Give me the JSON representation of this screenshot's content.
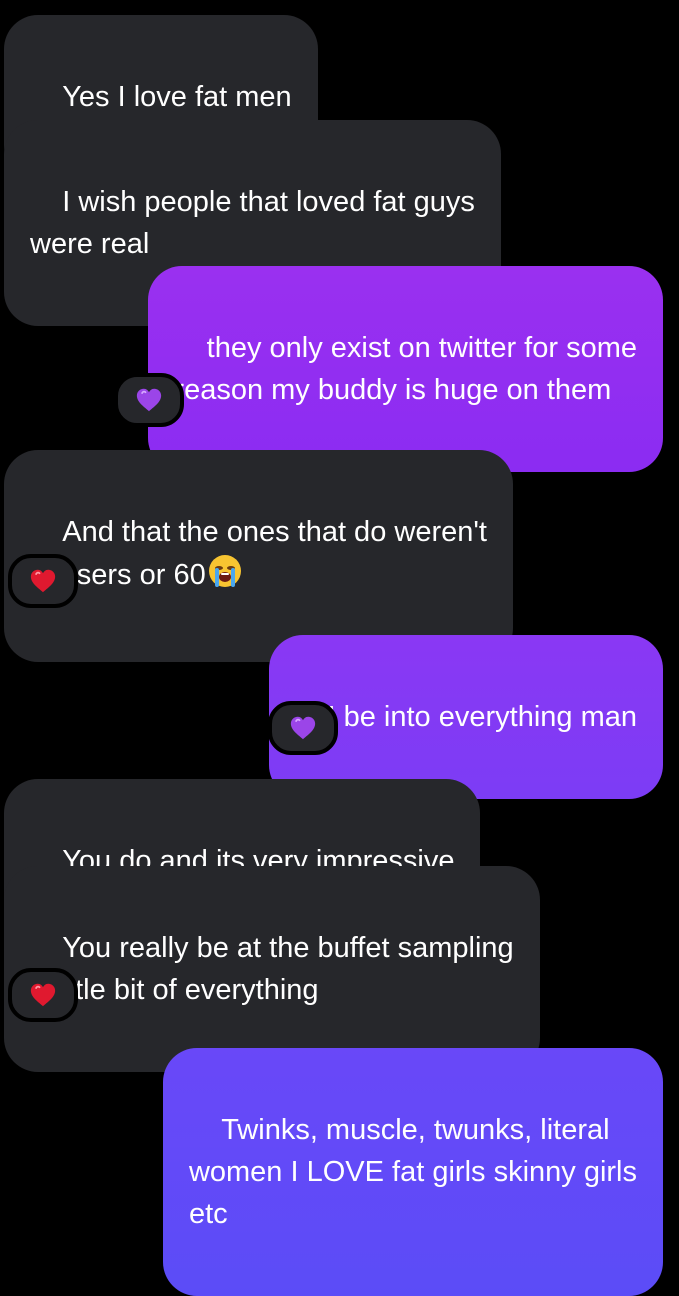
{
  "messages": [
    {
      "id": "m1",
      "direction": "incoming",
      "text": "Yes I love fat men"
    },
    {
      "id": "m2",
      "direction": "incoming",
      "text": "I wish people that loved fat guys\nwere real"
    },
    {
      "id": "m3",
      "direction": "outgoing",
      "text": "they only exist on twitter for some\nreason my buddy is huge on them",
      "reaction": "purple-heart"
    },
    {
      "id": "m4",
      "direction": "incoming",
      "text": "And that the ones that do weren't\nchasers or 60",
      "trailing_emoji": "loudly-crying-face",
      "reaction": "red-heart"
    },
    {
      "id": "m5",
      "direction": "outgoing",
      "text": "I be into everything man",
      "reaction": "purple-heart"
    },
    {
      "id": "m6",
      "direction": "incoming",
      "text": "You do and its very impressive"
    },
    {
      "id": "m7",
      "direction": "incoming",
      "text": "You really be at the buffet sampling\na little bit of everything",
      "reaction": "red-heart"
    },
    {
      "id": "m8",
      "direction": "outgoing",
      "text": "Twinks, muscle, twunks, literal\nwomen I LOVE fat girls skinny girls\netc"
    }
  ],
  "colors": {
    "background": "#000000",
    "incoming_bubble": "#26272b",
    "outgoing_bubble_top": "#9a30f0",
    "outgoing_bubble_bottom": "#5b4cf7",
    "text": "#ffffff",
    "red_heart": "#e0192f",
    "purple_heart": "#9b45e8"
  }
}
